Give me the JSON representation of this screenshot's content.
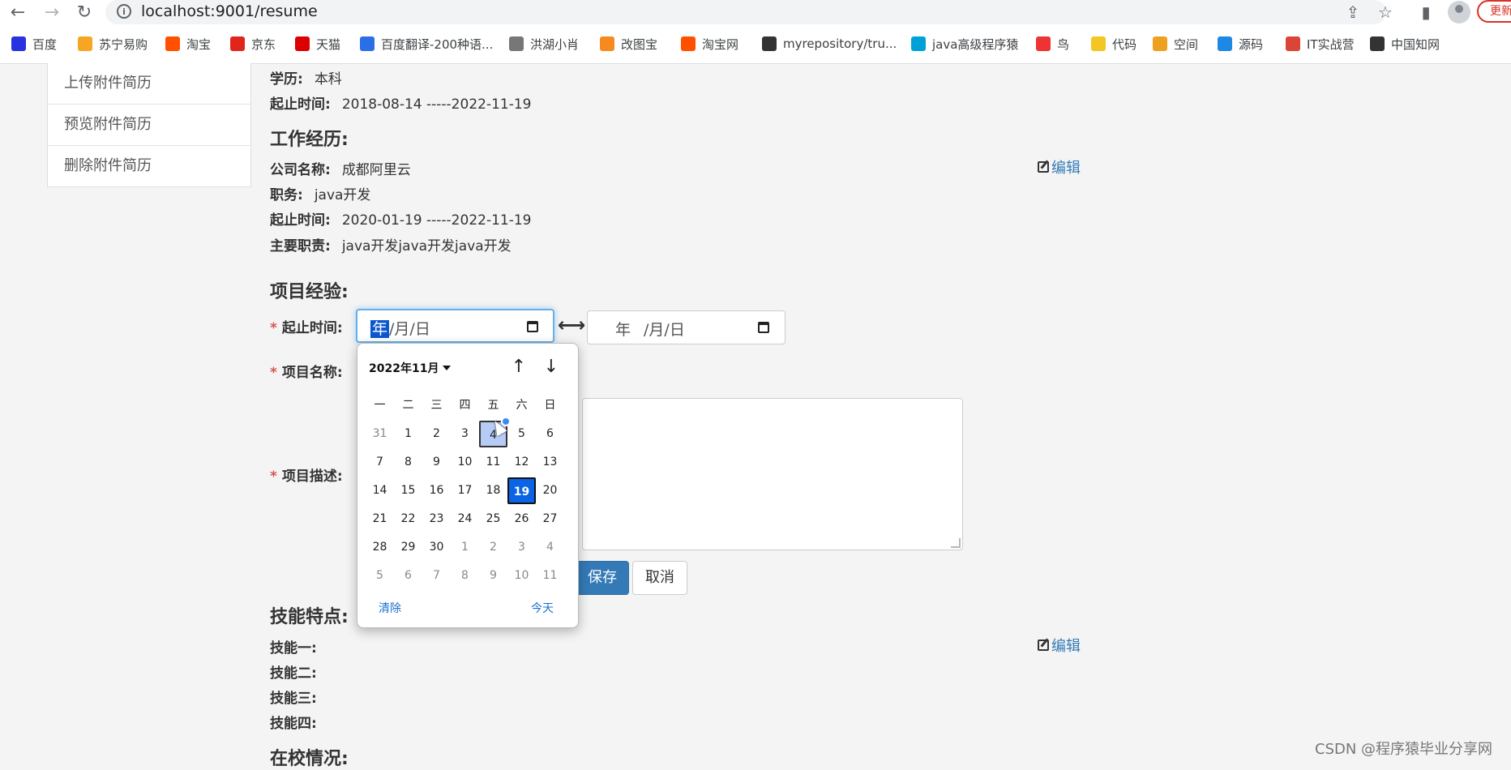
{
  "browser": {
    "url": "localhost:9001/resume",
    "update_label": "更新",
    "bookmarks": [
      {
        "label": "百度",
        "icon": "baidu-icon",
        "color": "#2932e1"
      },
      {
        "label": "苏宁易购",
        "icon": "suning-icon",
        "color": "#f5a623"
      },
      {
        "label": "淘宝",
        "icon": "taobao-icon",
        "color": "#ff5000"
      },
      {
        "label": "京东",
        "icon": "jd-icon",
        "color": "#e1251b"
      },
      {
        "label": "天猫",
        "icon": "tmall-icon",
        "color": "#d00"
      },
      {
        "label": "百度翻译-200种语...",
        "icon": "translate-icon",
        "color": "#2b6fe7"
      },
      {
        "label": "洪湖小肖",
        "icon": "bird-icon",
        "color": "#777"
      },
      {
        "label": "改图宝",
        "icon": "gaitubao-icon",
        "color": "#f58b1f"
      },
      {
        "label": "淘宝网",
        "icon": "taobao-icon",
        "color": "#ff5000"
      },
      {
        "label": "myrepository/tru...",
        "icon": "chrome-icon",
        "color": "#333"
      },
      {
        "label": "java高级程序猿",
        "icon": "bilibili-icon",
        "color": "#00a1d6"
      },
      {
        "label": "鸟",
        "icon": "bird-icon",
        "color": "#e33"
      },
      {
        "label": "代码",
        "icon": "code-icon",
        "color": "#f3c623"
      },
      {
        "label": "空间",
        "icon": "qzone-icon",
        "color": "#f0a020"
      },
      {
        "label": "源码",
        "icon": "fish-icon",
        "color": "#1e88e5"
      },
      {
        "label": "IT实战营",
        "icon": "chrome-icon",
        "color": "#db4437"
      },
      {
        "label": "中国知网",
        "icon": "cnki-icon",
        "color": "#333"
      }
    ]
  },
  "sidebar": {
    "items": [
      "上传附件简历",
      "预览附件简历",
      "删除附件简历"
    ]
  },
  "education": {
    "degree_label": "学历:",
    "degree_value": "本科",
    "time_label": "起止时间:",
    "time_value": "2018-08-14 -----2022-11-19"
  },
  "work": {
    "title": "工作经历:",
    "company_label": "公司名称:",
    "company_value": "成都阿里云",
    "position_label": "职务:",
    "position_value": "java开发",
    "time_label": "起止时间:",
    "time_value": "2020-01-19 -----2022-11-19",
    "duty_label": "主要职责:",
    "duty_value": "java开发java开发java开发",
    "edit_label": "编辑"
  },
  "project": {
    "title": "项目经验:",
    "time_label": "起止时间:",
    "name_label": "项目名称:",
    "desc_label": "项目描述:",
    "start_date": {
      "year": "年",
      "rest": "/月/日"
    },
    "end_date": {
      "year": "年",
      "rest": "/月/日"
    },
    "save_label": "保存",
    "cancel_label": "取消"
  },
  "calendar": {
    "month_label": "2022年11月",
    "weekdays": [
      "一",
      "二",
      "三",
      "四",
      "五",
      "六",
      "日"
    ],
    "days": [
      [
        "31",
        "1",
        "2",
        "3",
        "4",
        "5",
        "6"
      ],
      [
        "7",
        "8",
        "9",
        "10",
        "11",
        "12",
        "13"
      ],
      [
        "14",
        "15",
        "16",
        "17",
        "18",
        "19",
        "20"
      ],
      [
        "21",
        "22",
        "23",
        "24",
        "25",
        "26",
        "27"
      ],
      [
        "28",
        "29",
        "30",
        "1",
        "2",
        "3",
        "4"
      ],
      [
        "5",
        "6",
        "7",
        "8",
        "9",
        "10",
        "11"
      ]
    ],
    "dim_cells": [
      [
        0,
        0
      ],
      [
        4,
        3
      ],
      [
        4,
        4
      ],
      [
        4,
        5
      ],
      [
        4,
        6
      ],
      [
        5,
        0
      ],
      [
        5,
        1
      ],
      [
        5,
        2
      ],
      [
        5,
        3
      ],
      [
        5,
        4
      ],
      [
        5,
        5
      ],
      [
        5,
        6
      ]
    ],
    "today_cell": [
      2,
      5
    ],
    "hover_cell": [
      0,
      4
    ],
    "clear_label": "清除",
    "today_label": "今天"
  },
  "skills": {
    "title": "技能特点:",
    "items": [
      "技能一:",
      "技能二:",
      "技能三:",
      "技能四:"
    ],
    "edit_label": "编辑"
  },
  "campus": {
    "title": "在校情况:"
  },
  "watermark": "CSDN @程序猿毕业分享网"
}
